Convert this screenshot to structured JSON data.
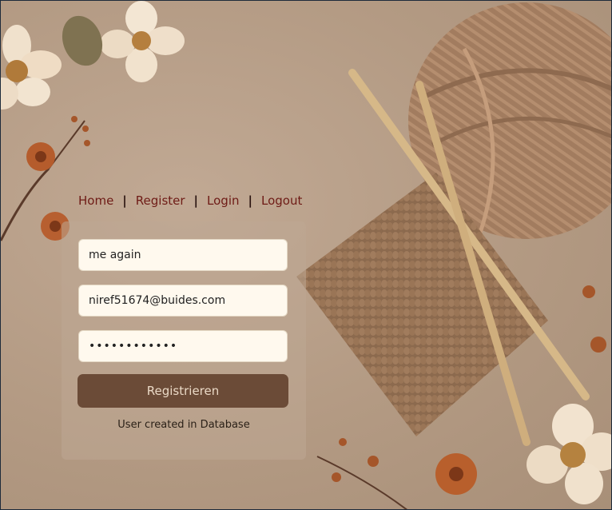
{
  "nav": {
    "home": "Home",
    "register": "Register",
    "login": "Login",
    "logout": "Logout",
    "separator": "|"
  },
  "form": {
    "username_value": "me again",
    "email_value": "niref51674@buides.com",
    "password_value": "••••••••••••",
    "submit_label": "Registrieren",
    "status_message": "User created in Database"
  },
  "colors": {
    "nav_link": "#6e1b16",
    "button_bg": "#6b4b37",
    "input_bg": "#fff9ee"
  },
  "background_icons": [
    "flower-icon",
    "yarn-ball-icon",
    "knitting-needle-icon",
    "knitted-swatch-icon"
  ]
}
